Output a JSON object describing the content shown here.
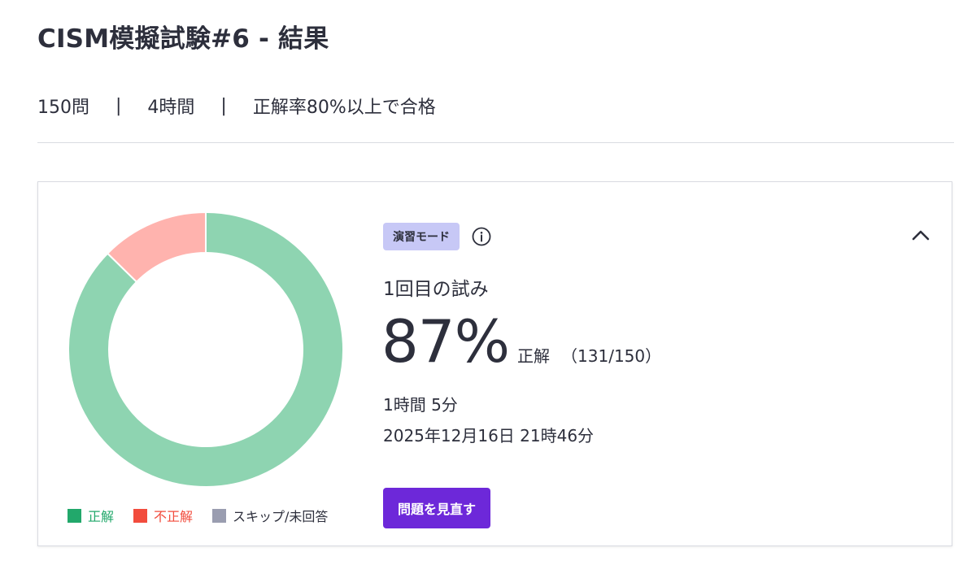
{
  "page": {
    "title": "CISM模擬試験#6 - 結果"
  },
  "meta": {
    "questions": "150問",
    "duration": "4時間",
    "pass_rule": "正解率80%以上で合格",
    "separator": "|"
  },
  "result": {
    "mode_badge": "演習モード",
    "attempt_label": "1回目の試み",
    "score_percent": "87%",
    "score_label": "正解",
    "score_count": "（131/150）",
    "time_taken": "1時間 5分",
    "completed_at": "2025年12月16日 21時46分",
    "review_button": "問題を見直す"
  },
  "icons": {
    "info": "info-icon",
    "collapse": "chevron-up-icon"
  },
  "colors": {
    "correct": "#8ed4b1",
    "incorrect": "#ffb3ae",
    "skipped": "#9a9db0",
    "legend_correct": "#22a86b",
    "legend_incorrect": "#f24c3d",
    "accent": "#6d28d9",
    "badge": "#c7c8f6"
  },
  "chart_data": {
    "type": "pie",
    "categories": [
      "正解",
      "不正解",
      "スキップ/未回答"
    ],
    "values": [
      131,
      19,
      0
    ],
    "colors": [
      "#8ed4b1",
      "#ffb3ae",
      "#9a9db0"
    ],
    "legend_colors": [
      "#22a86b",
      "#f24c3d",
      "#9a9db0"
    ],
    "legend_text_colors": [
      "#22a86b",
      "#f24c3d",
      "#2d2f3c"
    ],
    "title": "",
    "legend_position": "bottom"
  }
}
